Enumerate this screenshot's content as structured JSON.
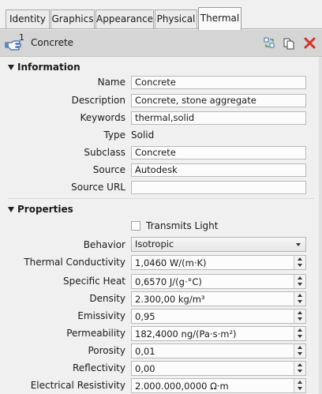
{
  "tabs": [
    {
      "label": "Identity"
    },
    {
      "label": "Graphics"
    },
    {
      "label": "Appearance"
    },
    {
      "label": "Physical"
    },
    {
      "label": "Thermal"
    }
  ],
  "header": {
    "number": "1",
    "title": "Concrete"
  },
  "information": {
    "title": "Information",
    "name_label": "Name",
    "name_value": "Concrete",
    "description_label": "Description",
    "description_value": "Concrete, stone aggregate",
    "keywords_label": "Keywords",
    "keywords_value": "thermal,solid",
    "type_label": "Type",
    "type_value": "Solid",
    "subclass_label": "Subclass",
    "subclass_value": "Concrete",
    "source_label": "Source",
    "source_value": "Autodesk",
    "source_url_label": "Source URL",
    "source_url_value": ""
  },
  "properties": {
    "title": "Properties",
    "transmits_light_label": "Transmits Light",
    "transmits_light_checked": false,
    "behavior_label": "Behavior",
    "behavior_value": "Isotropic",
    "thermal_conductivity_label": "Thermal Conductivity",
    "thermal_conductivity_value": "1,0460 W/(m·K)",
    "specific_heat_label": "Specific Heat",
    "specific_heat_value": "0,6570 J/(g·°C)",
    "density_label": "Density",
    "density_value": "2.300,00 kg/m³",
    "emissivity_label": "Emissivity",
    "emissivity_value": "0,95",
    "permeability_label": "Permeability",
    "permeability_value": "182,4000 ng/(Pa·s·m²)",
    "porosity_label": "Porosity",
    "porosity_value": "0,01",
    "reflectivity_label": "Reflectivity",
    "reflectivity_value": "0,00",
    "electrical_resistivity_label": "Electrical Resistivity",
    "electrical_resistivity_value": "2.000.000,0000 Ω·m"
  },
  "icons": {
    "header": "material-hand-icon",
    "duplicate": "duplicate-icon",
    "copy": "copy-icon",
    "delete": "delete-icon"
  },
  "colors": {
    "delete_red": "#d9302a",
    "header_bg": "#d5d5d5"
  }
}
